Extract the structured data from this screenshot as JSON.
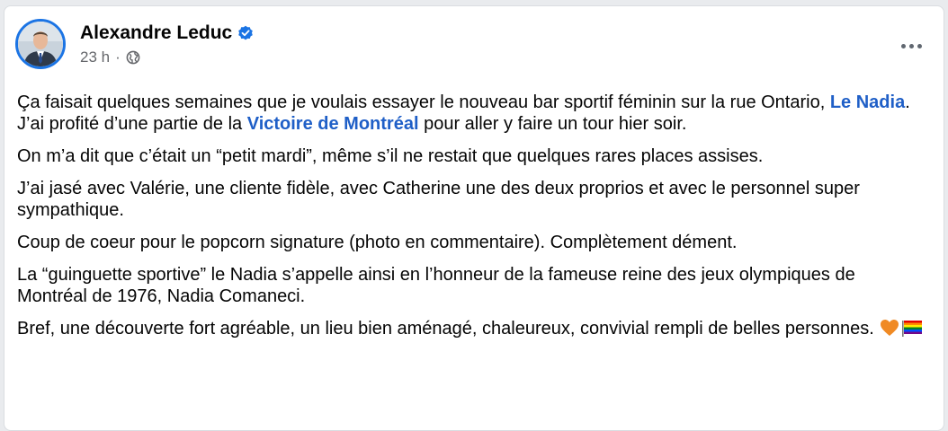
{
  "post": {
    "author": "Alexandre Leduc",
    "verified_icon": "verified-badge-icon",
    "timestamp": "23 h",
    "separator": "·",
    "audience_icon": "globe-icon",
    "more_icon": "more-options-icon",
    "paragraphs": {
      "p1": {
        "a": "Ça faisait quelques semaines que je voulais essayer le nouveau bar sportif féminin sur la rue Ontario, ",
        "link1": "Le Nadia",
        "b": ". J’ai profité d’une partie de la ",
        "link2": "Victoire de Montréal",
        "c": " pour aller y faire un tour hier soir."
      },
      "p2": "On m’a dit que c’était un “petit mardi”, même s’il ne restait que quelques rares places assises.",
      "p3": "J’ai jasé avec Valérie, une cliente fidèle, avec Catherine une des deux proprios et avec le personnel super sympathique.",
      "p4": "Coup de coeur pour le popcorn signature (photo en commentaire). Complètement dément.",
      "p5": "La “guinguette sportive” le Nadia s’appelle ainsi en l’honneur de la fameuse reine des jeux olympiques de Montréal de 1976, Nadia Comaneci.",
      "p6": "Bref, une découverte fort agréable, un lieu bien aménagé, chaleureux, convivial rempli de belles personnes."
    },
    "emojis": [
      "orange-heart-icon",
      "rainbow-flag-icon"
    ]
  },
  "colors": {
    "link": "#1f5fc7",
    "verified": "#1b74e4",
    "secondary_text": "#65676b"
  }
}
